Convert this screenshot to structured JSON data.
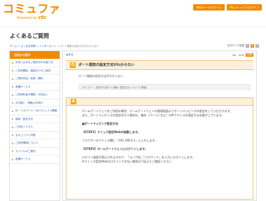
{
  "header": {
    "logo_text": "コミュファ",
    "logo_sub_prefix": "Powered by",
    "logo_sub_brand": "ctc",
    "btn_web": "Webメールログイン",
    "btn_my": "Myコミュファログイン"
  },
  "page_title": "よくあるご質問",
  "breadcrumb": {
    "items": [
      "ホーム",
      "よくある質問",
      "インターネット",
      "ポート開放の設定方法がわからない"
    ],
    "sep": " > "
  },
  "font_size": {
    "label": "文字サイズ変更",
    "small": "小",
    "medium": "中",
    "large": "大"
  },
  "sidebar": {
    "heading": "目的から探す",
    "items": [
      "お申し込みをご検討中のお客さま",
      "ご利用開始・接続までのご案内",
      "ご契約内容・変更・解約",
      "各種サービス",
      "ご利用料金の確認・お支払い",
      "お引越し・移転の手続き",
      "ID・パスワード・Myコミュファ関連",
      "接続・設定方法",
      "ご利用トラブル",
      "セキュリティ対策",
      "ご利用環境について",
      "モバイルのご案内",
      "各種サービス"
    ]
  },
  "main": {
    "back": "◀ 戻る",
    "no_label": "No.",
    "no_value": "1935",
    "print": "印刷",
    "q_icon": "Q",
    "question_title": "ポート開放の設定方法がわからない",
    "question_text": "ポート開放の設定方法がわからない",
    "category_path": "カテゴリー：目的から探す > 接続・設定方法 > パソコン関連",
    "a_icon": "A",
    "answer": {
      "intro1": "ホームゲートウェイをご利用の場合、ホームゲートウェイの管理画面よりポートマッピングの設定をしていただけます。",
      "intro2": "また、ポートマッピングの設定を行う場合は、端末（パソコンなど）のIPアドレスを固定する必要がございます。",
      "section": "■ポートマッピング設定方法",
      "step1": "【STEP1】クイック設定Webの起動します。",
      "step1_text": "ブラウザーのアドレス欄に「192.168.0.1」と入力します。",
      "step2": "【STEP2】ホームゲートウェイにログインします。",
      "step2_text": "ログイン画面が表示されますので、「ユーザ名」「パスワード」を入力しログインします。",
      "note": "※クイック設定Webのログインできない場合は下記よりご確認ください"
    }
  }
}
